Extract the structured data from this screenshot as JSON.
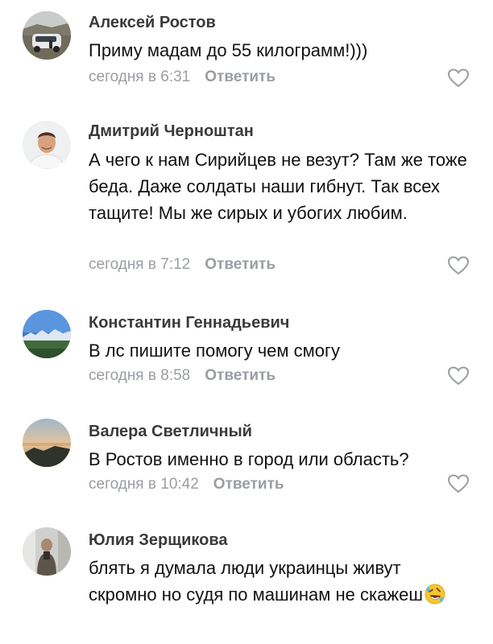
{
  "comments": [
    {
      "author": "Алексей Ростов",
      "text": "Приму мадам до 55 килограмм!)))",
      "time": "сегодня в 6:31",
      "reply_label": "Ответить",
      "like_icon": "heart-outline-icon"
    },
    {
      "author": "Дмитрий Черноштан",
      "text": "А чего к нам Сирийцев не везут? Там же тоже беда. Даже солдаты наши гибнут. Так всех тащите! Мы же сирых и убогих любим.",
      "time": "сегодня в 7:12",
      "reply_label": "Ответить",
      "like_icon": "heart-outline-icon"
    },
    {
      "author": "Константин Геннадьевич",
      "text": "В лс пишите помогу чем смогу",
      "time": "сегодня в 8:58",
      "reply_label": "Ответить",
      "like_icon": "heart-outline-icon"
    },
    {
      "author": "Валера Светличный",
      "text": "В Ростов именно в город или область?",
      "time": "сегодня в 10:42",
      "reply_label": "Ответить",
      "like_icon": "heart-outline-icon"
    },
    {
      "author": "Юлия Зерщикова",
      "text": "блять я думала  люди украинцы живут скромно но судя по машинам не скажеш",
      "emoji": "rolling-on-floor-laughing-emoji"
    }
  ],
  "colors": {
    "author": "#3a3a3a",
    "text": "#111111",
    "meta": "#9a9da2"
  }
}
